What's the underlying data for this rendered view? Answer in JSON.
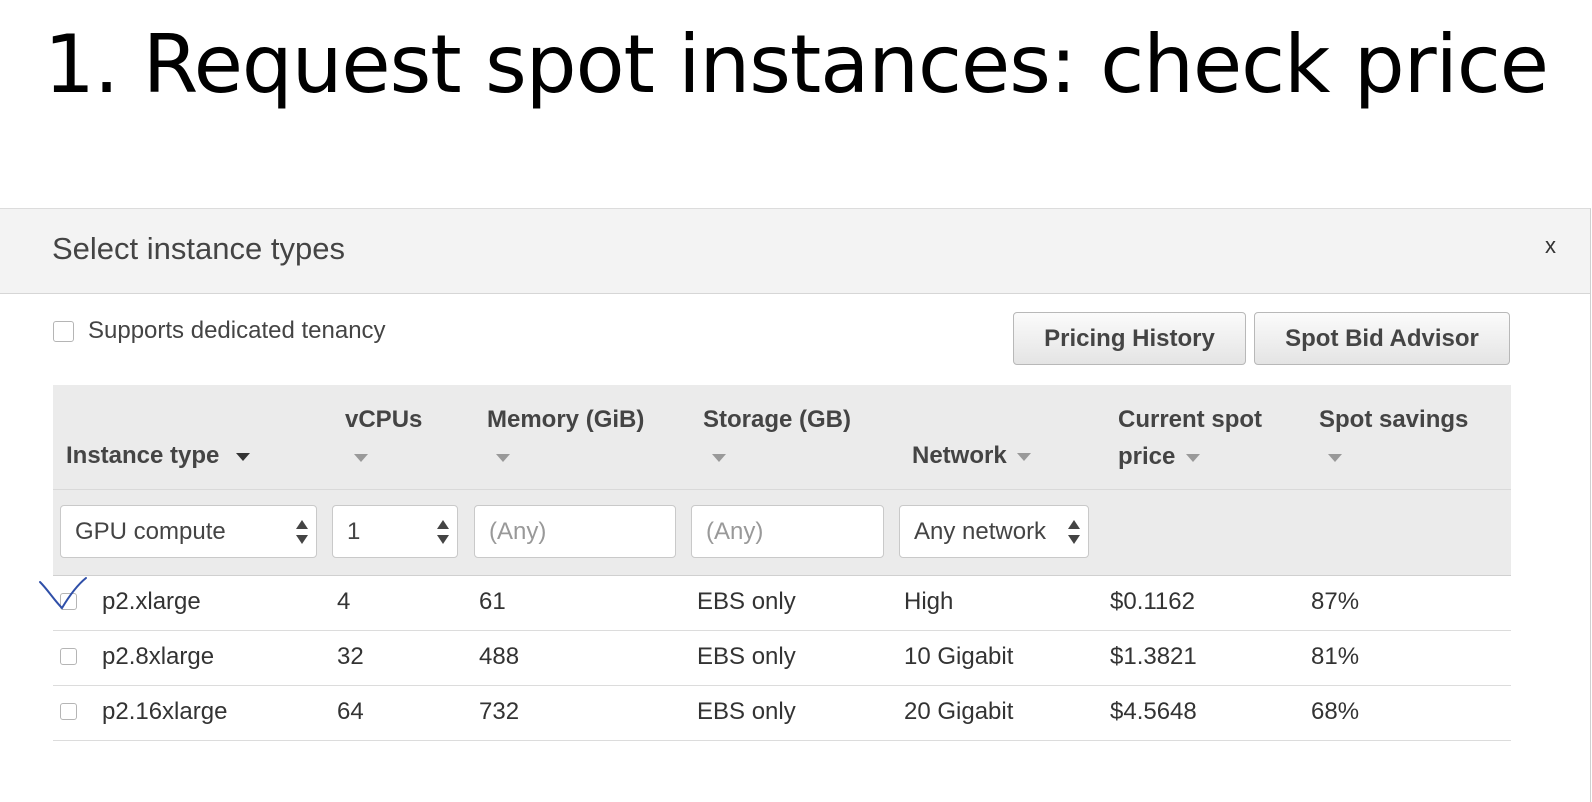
{
  "slide_title": "1.  Request spot instances: check price",
  "modal": {
    "title": "Select instance types",
    "close_label": "x",
    "tenancy_label": "Supports dedicated tenancy",
    "buttons": {
      "pricing_history": "Pricing History",
      "spot_bid_advisor": "Spot Bid Advisor"
    }
  },
  "table": {
    "headers": {
      "instance_type": "Instance type",
      "vcpus": "vCPUs",
      "memory": "Memory (GiB)",
      "storage": "Storage (GB)",
      "network": "Network",
      "spot_price_line1": "Current spot",
      "spot_price_line2": "price",
      "savings": "Spot savings"
    },
    "filters": {
      "instance_family": "GPU compute",
      "vcpus": "1",
      "memory_placeholder": "(Any)",
      "storage_placeholder": "(Any)",
      "network": "Any network"
    },
    "rows": [
      {
        "type": "p2.xlarge",
        "vcpus": "4",
        "memory": "61",
        "storage": "EBS only",
        "network": "High",
        "price": "$0.1162",
        "savings": "87%",
        "checked": true
      },
      {
        "type": "p2.8xlarge",
        "vcpus": "32",
        "memory": "488",
        "storage": "EBS only",
        "network": "10 Gigabit",
        "price": "$1.3821",
        "savings": "81%",
        "checked": false
      },
      {
        "type": "p2.16xlarge",
        "vcpus": "64",
        "memory": "732",
        "storage": "EBS only",
        "network": "20 Gigabit",
        "price": "$4.5648",
        "savings": "68%",
        "checked": false
      }
    ]
  },
  "colors": {
    "annotation_check": "#2f4fa8",
    "header_bg": "#f3f3f3",
    "table_header_bg": "#ebebeb"
  },
  "icons": {
    "close": "close-icon",
    "sort": "caret-down-icon",
    "select": "updown-icon",
    "annotation": "handwritten-checkmark-icon"
  }
}
